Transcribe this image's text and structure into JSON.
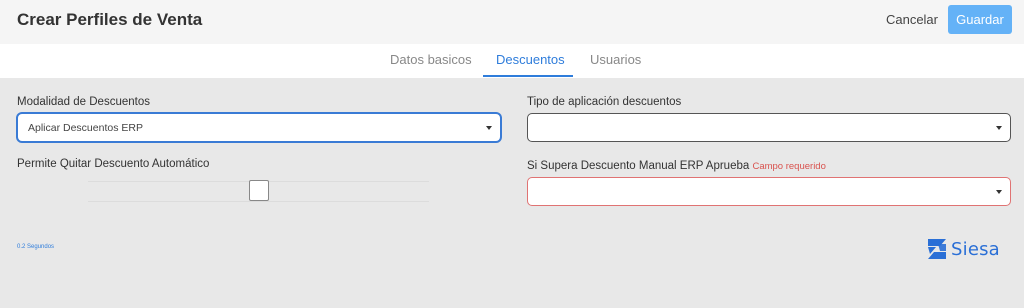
{
  "header": {
    "title": "Crear Perfiles de Venta",
    "cancel_label": "Cancelar",
    "save_label": "Guardar"
  },
  "tabs": [
    {
      "label": "Datos basicos",
      "active": false
    },
    {
      "label": "Descuentos",
      "active": true
    },
    {
      "label": "Usuarios",
      "active": false
    }
  ],
  "form": {
    "modalidad": {
      "label": "Modalidad de Descuentos",
      "value": "Aplicar Descuentos ERP"
    },
    "tipo_aplicacion": {
      "label": "Tipo de aplicación descuentos",
      "value": ""
    },
    "permite_quitar": {
      "label": "Permite Quitar Descuento Automático",
      "checked": false
    },
    "supera_descuento": {
      "label": "Si Supera Descuento Manual ERP Aprueba",
      "error": "Campo requerido",
      "value": ""
    }
  },
  "footer": {
    "timing": "0.2 Segundos",
    "brand": "Siesa"
  },
  "colors": {
    "accent": "#2f7ddb",
    "save_button": "#64b2f7",
    "error": "#d9534f",
    "background": "#e8e8e8",
    "brand": "#2a6fd6"
  },
  "icons": [
    "chevron-down-icon",
    "siesa-logo-icon"
  ]
}
